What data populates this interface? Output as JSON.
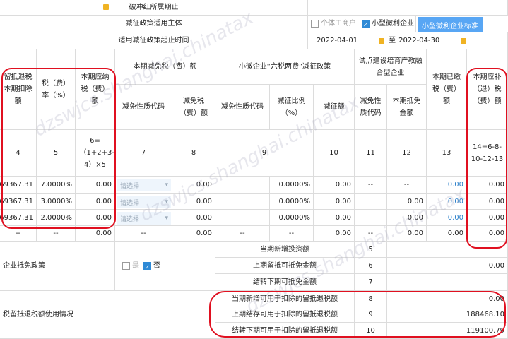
{
  "header": {
    "period_label": "破冲红所属期止",
    "subject_label": "减征政策适用主体",
    "opt_individual": "个体工商户",
    "opt_small": "小型微利企业",
    "small_button": "小型微利企业标准",
    "dates_label": "适用减征政策起止时间",
    "date_start": "2022-04-01",
    "date_sep": "至",
    "date_end": "2022-04-30"
  },
  "columns": {
    "c1": "留抵退税本期扣除额",
    "c2": "税（费）率（%）",
    "c3": "本期应纳税（费）额",
    "g1": "本期减免税（费）额",
    "g2": "小微企业“六税两费”减征政策",
    "g3": "试点建设培育产教融合型企业",
    "c13": "本期已缴税（费）额",
    "c14": "本期应补（退）税（费）额",
    "s7": "减免性质代码",
    "s8": "减免税（费）额",
    "s9": "减免性质代码",
    "s10": "减征比例（%）",
    "s11": "减征额",
    "s12": "减免性质代码",
    "s13": "本期抵免金额"
  },
  "formula_row": [
    "4",
    "5",
    "6=（1+2+3-4）×5",
    "7",
    "8",
    "9",
    "10",
    "11",
    "12",
    "13",
    "14=6-8-10-12-13"
  ],
  "rows": [
    {
      "deduct": "69367.31",
      "rate": "7.0000%",
      "payable": "0.00",
      "code": "请选择",
      "reduced": "0.00",
      "pct": "0.0000%",
      "reduce_amt": "0.00",
      "code2": "--",
      "credit": "--",
      "paid": "0.00",
      "due": "0.00"
    },
    {
      "deduct": "69367.31",
      "rate": "3.0000%",
      "payable": "0.00",
      "code": "请选择",
      "reduced": "0.00",
      "pct": "0.0000%",
      "reduce_amt": "0.00",
      "code2": "",
      "credit": "0.00",
      "paid": "0.00",
      "due": "0.00"
    },
    {
      "deduct": "69367.31",
      "rate": "2.0000%",
      "payable": "0.00",
      "code": "请选择",
      "reduced": "0.00",
      "pct": "0.0000%",
      "reduce_amt": "0.00",
      "code2": "",
      "credit": "0.00",
      "paid": "0.00",
      "due": "0.00"
    }
  ],
  "total_row": {
    "a": "--",
    "b": "--",
    "payable": "0.00",
    "code": "--",
    "reduced": "0.00",
    "code2": "--",
    "pct": "--",
    "reduce_amt": "0.00",
    "c": "--",
    "credit": "0.00",
    "paid": "0.00",
    "due": "0.00"
  },
  "bottom": {
    "policy_label": "企业抵免政策",
    "yes": "是",
    "no": "否",
    "usage_label": "税留抵退税额使用情况",
    "items": [
      {
        "label": "当期新增投资额",
        "no": "5",
        "value": ""
      },
      {
        "label": "上期留抵可抵免金额",
        "no": "6",
        "value": "0.00"
      },
      {
        "label": "结转下期可抵免金额",
        "no": "7",
        "value": ""
      },
      {
        "label": "当期新增可用于扣除的留抵退税额",
        "no": "8",
        "value": "0.00"
      },
      {
        "label": "上期结存可用于扣除的留抵退税额",
        "no": "9",
        "value": "188468.10"
      },
      {
        "label": "结转下期可用于扣除的留抵退税额",
        "no": "10",
        "value": "119100.79"
      }
    ]
  },
  "watermark": "dzswjcs.shanghai.chinatax"
}
